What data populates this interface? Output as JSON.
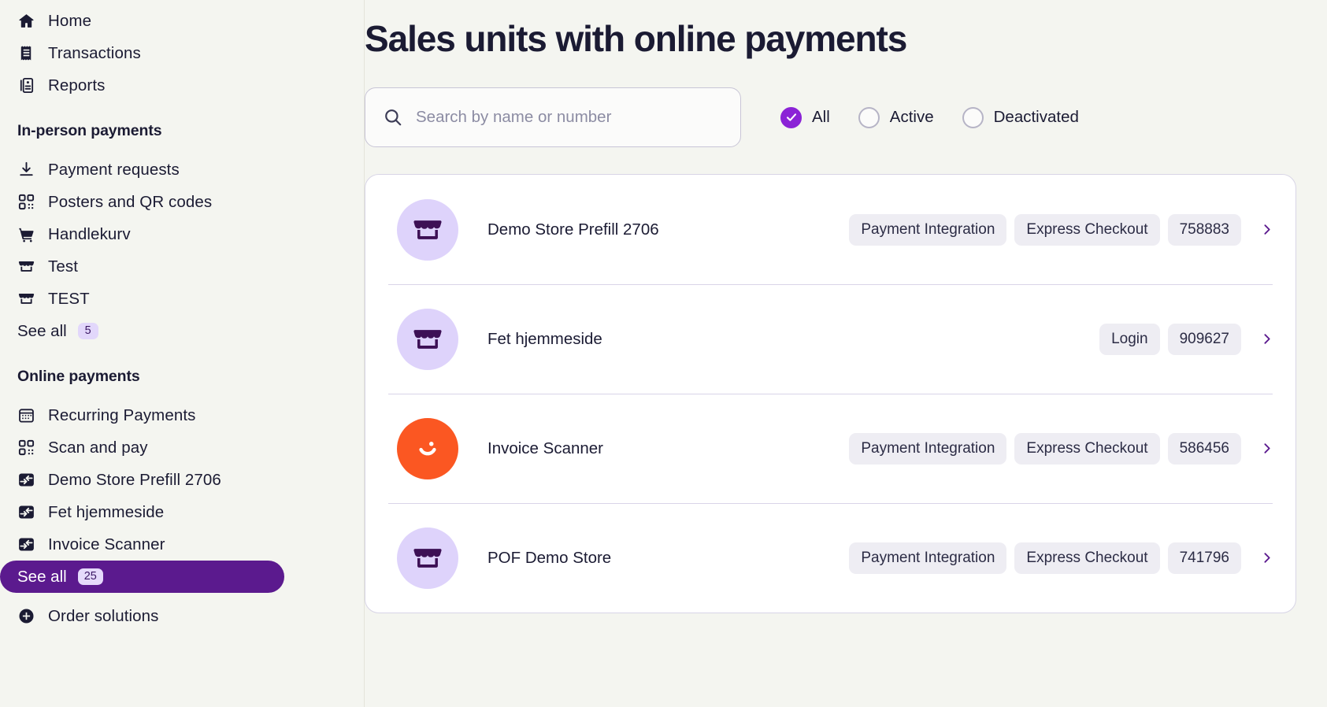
{
  "sidebar": {
    "top_items": [
      {
        "label": "Home",
        "icon": "home-icon"
      },
      {
        "label": "Transactions",
        "icon": "receipt-icon"
      },
      {
        "label": "Reports",
        "icon": "report-icon"
      }
    ],
    "sections": [
      {
        "title": "In-person payments",
        "items": [
          {
            "label": "Payment requests",
            "icon": "download-icon"
          },
          {
            "label": "Posters and QR codes",
            "icon": "qr-icon"
          },
          {
            "label": "Handlekurv",
            "icon": "cart-icon"
          },
          {
            "label": "Test",
            "icon": "store-icon"
          },
          {
            "label": "TEST",
            "icon": "store-icon"
          }
        ],
        "see_all": {
          "label": "See all",
          "count": "5",
          "active": false
        }
      },
      {
        "title": "Online payments",
        "items": [
          {
            "label": "Recurring Payments",
            "icon": "calendar-icon"
          },
          {
            "label": "Scan and pay",
            "icon": "qr-icon"
          },
          {
            "label": "Demo Store Prefill 2706",
            "icon": "online-unit-icon"
          },
          {
            "label": "Fet hjemmeside",
            "icon": "online-unit-icon"
          },
          {
            "label": "Invoice Scanner",
            "icon": "online-unit-icon"
          }
        ],
        "see_all": {
          "label": "See all",
          "count": "25",
          "active": true
        }
      }
    ],
    "footer_item": {
      "label": "Order solutions",
      "icon": "plus-circle-icon"
    }
  },
  "header": {
    "title": "Sales units with online payments"
  },
  "search": {
    "placeholder": "Search by name or number",
    "value": ""
  },
  "filters": [
    {
      "label": "All",
      "checked": true
    },
    {
      "label": "Active",
      "checked": false
    },
    {
      "label": "Deactivated",
      "checked": false
    }
  ],
  "units": [
    {
      "name": "Demo Store Prefill 2706",
      "avatar": "store-icon",
      "tags": [
        "Payment Integration",
        "Express Checkout",
        "758883"
      ]
    },
    {
      "name": "Fet hjemmeside",
      "avatar": "store-icon",
      "tags": [
        "Login",
        "909627"
      ]
    },
    {
      "name": "Invoice Scanner",
      "avatar": "smiley-icon",
      "tags": [
        "Payment Integration",
        "Express Checkout",
        "586456"
      ]
    },
    {
      "name": "POF Demo Store",
      "avatar": "store-icon",
      "tags": [
        "Payment Integration",
        "Express Checkout",
        "741796"
      ]
    }
  ],
  "colors": {
    "page_bg": "#f4f5f0",
    "accent_purple": "#5b1a8e",
    "radio_purple": "#8b23d6",
    "avatar_lavender": "#ded3fb",
    "avatar_orange": "#fb5722",
    "tag_bg": "#eeedf3"
  }
}
